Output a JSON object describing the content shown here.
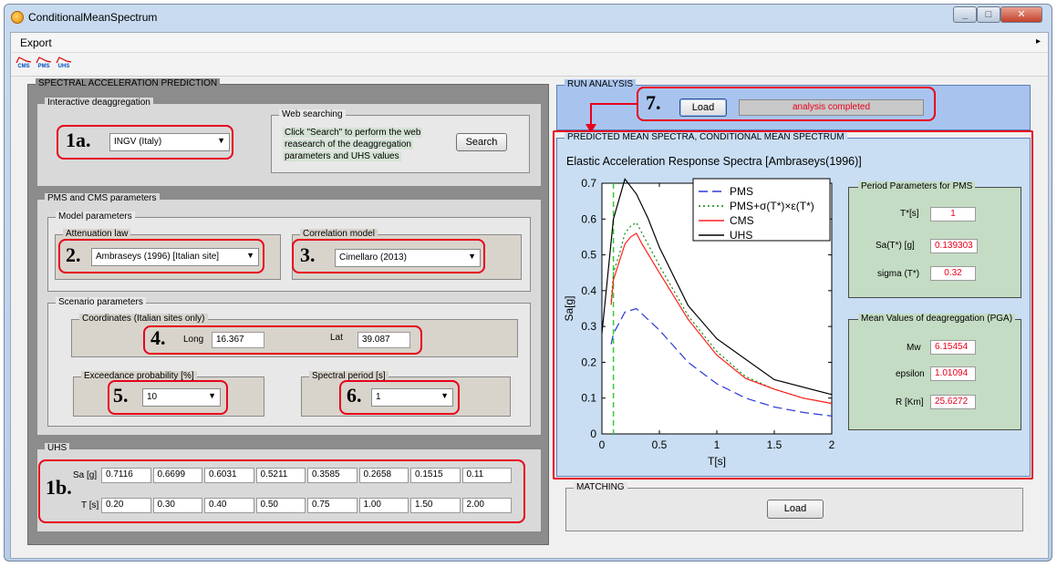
{
  "window": {
    "title": "ConditionalMeanSpectrum"
  },
  "menu": {
    "export": "Export",
    "overflow": "▸"
  },
  "toolbar": {
    "items": [
      {
        "name": "CMS"
      },
      {
        "name": "PMS"
      },
      {
        "name": "UHS"
      }
    ]
  },
  "spectral": {
    "title": "SPECTRAL ACCELERATION PREDICTION",
    "deagg": {
      "title": "Interactive deaggregation",
      "step": "1a.",
      "source_value": "INGV (Italy)",
      "web": {
        "title": "Web searching",
        "text1": "Click \"Search\" to perform the web",
        "text2": "reasearch of the deaggregation",
        "text3": "parameters and UHS values",
        "search": "Search"
      }
    },
    "pms_cms": {
      "title": "PMS and CMS parameters",
      "model": {
        "title": "Model parameters",
        "attenuation_title": "Attenuation law",
        "attenuation_step": "2.",
        "attenuation_value": "Ambraseys (1996) [Italian site]",
        "correlation_title": "Correlation model",
        "correlation_step": "3.",
        "correlation_value": "Cimellaro (2013)"
      },
      "scenario": {
        "title": "Scenario parameters",
        "coords_title": "Coordinates (Italian sites only)",
        "coords_step": "4.",
        "long_label": "Long",
        "long_value": "16.367",
        "lat_label": "Lat",
        "lat_value": "39.087",
        "exceed_title": "Exceedance probability [%]",
        "exceed_step": "5.",
        "exceed_value": "10",
        "period_title": "Spectral period [s]",
        "period_step": "6.",
        "period_value": "1"
      }
    },
    "uhs": {
      "title": "UHS",
      "step": "1b.",
      "sa_label": "Sa [g]",
      "t_label": "T [s]",
      "sa_values": [
        "0.7116",
        "0.6699",
        "0.6031",
        "0.5211",
        "0.3585",
        "0.2658",
        "0.1515",
        "0.11"
      ],
      "t_values": [
        "0.20",
        "0.30",
        "0.40",
        "0.50",
        "0.75",
        "1.00",
        "1.50",
        "2.00"
      ]
    }
  },
  "run": {
    "title": "RUN ANALYSIS",
    "step": "7.",
    "load": "Load",
    "status": "analysis completed"
  },
  "predicted": {
    "title": "PREDICTED MEAN SPECTRA, CONDITIONAL MEAN SPECTRUM",
    "period_params": {
      "title": "Period Parameters for PMS",
      "t_label": "T*[s]",
      "t_value": "1",
      "sa_label": "Sa(T*) [g]",
      "sa_value": "0.139303",
      "sigma_label": "sigma (T*)",
      "sigma_value": "0.32"
    },
    "mean_values": {
      "title": "Mean Values of deagreggation (PGA)",
      "mw_label": "Mw",
      "mw_value": "6.15454",
      "eps_label": "epsilon",
      "eps_value": "1.01094",
      "r_label": "R [Km]",
      "r_value": "25.6272"
    }
  },
  "matching": {
    "title": "MATCHING",
    "load": "Load"
  },
  "chart_data": {
    "type": "line",
    "title": "Elastic Acceleration Response Spectra [Ambraseys(1996)]",
    "xlabel": "T[s]",
    "ylabel": "Sa[g]",
    "xlim": [
      0,
      2
    ],
    "ylim": [
      0,
      0.7
    ],
    "xticks": [
      "0",
      "0.5",
      "1",
      "1.5",
      "2"
    ],
    "yticks": [
      "0",
      "0.1",
      "0.2",
      "0.3",
      "0.4",
      "0.5",
      "0.6",
      "0.7"
    ],
    "grid": false,
    "legend_position": "top-right",
    "series": [
      {
        "name": "PMS",
        "color": "#2a3bd6",
        "style": "dashed",
        "x": [
          0.08,
          0.1,
          0.15,
          0.2,
          0.25,
          0.3,
          0.35,
          0.5,
          0.75,
          1.0,
          1.25,
          1.5,
          1.75,
          2.0
        ],
        "y": [
          0.25,
          0.28,
          0.31,
          0.34,
          0.345,
          0.35,
          0.335,
          0.29,
          0.2,
          0.14,
          0.1,
          0.075,
          0.06,
          0.05
        ]
      },
      {
        "name": "PMS+σ(T*)×ε(T*)",
        "color": "#0a8a0a",
        "style": "dotted",
        "x": [
          0.08,
          0.1,
          0.15,
          0.2,
          0.25,
          0.3,
          0.35,
          0.5,
          0.75,
          1.0,
          1.25,
          1.5,
          1.75,
          2.0
        ],
        "y": [
          0.37,
          0.45,
          0.5,
          0.56,
          0.58,
          0.59,
          0.56,
          0.47,
          0.33,
          0.23,
          0.16,
          0.125,
          0.1,
          0.085
        ]
      },
      {
        "name": "CMS",
        "color": "#ff2020",
        "style": "solid",
        "x": [
          0.08,
          0.1,
          0.15,
          0.2,
          0.25,
          0.3,
          0.35,
          0.5,
          0.75,
          1.0,
          1.25,
          1.5,
          1.75,
          2.0
        ],
        "y": [
          0.36,
          0.43,
          0.48,
          0.53,
          0.55,
          0.56,
          0.53,
          0.45,
          0.32,
          0.22,
          0.155,
          0.125,
          0.1,
          0.085
        ]
      },
      {
        "name": "UHS",
        "color": "#000000",
        "style": "solid",
        "x": [
          0.0,
          0.1,
          0.2,
          0.3,
          0.4,
          0.5,
          0.75,
          1.0,
          1.5,
          2.0
        ],
        "y": [
          0.28,
          0.6,
          0.7116,
          0.6699,
          0.6031,
          0.5211,
          0.3585,
          0.2658,
          0.1515,
          0.11
        ]
      }
    ],
    "vertical_marker": {
      "x": 0.1,
      "color": "#33cc33",
      "style": "dashed"
    }
  }
}
